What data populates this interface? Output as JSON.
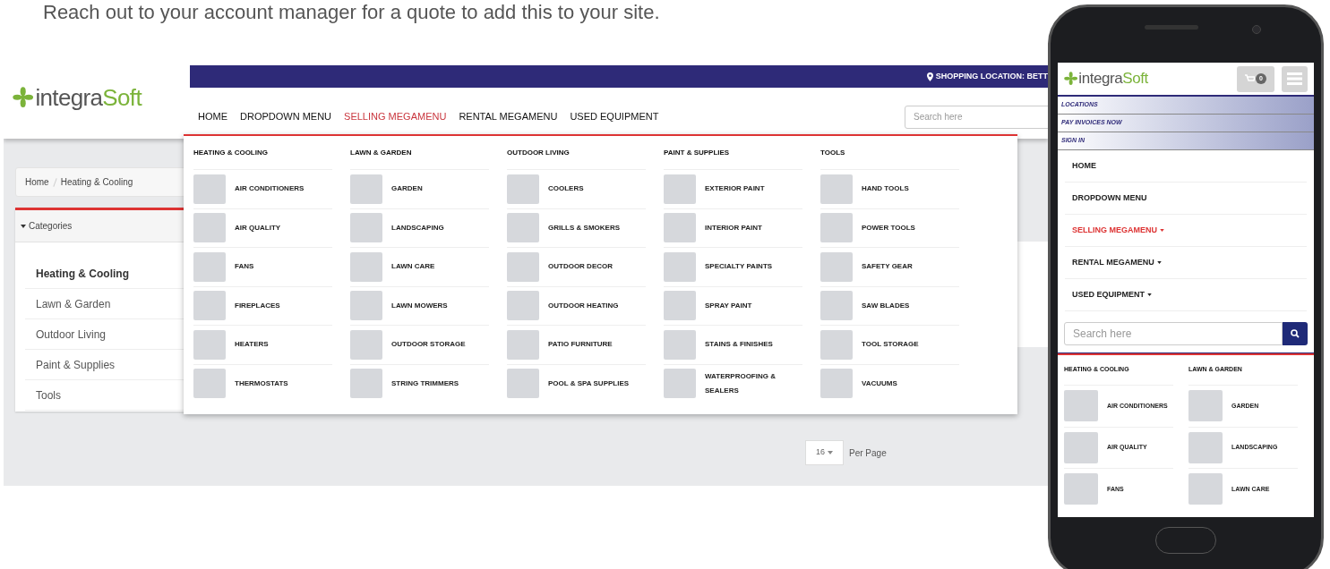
{
  "caption": "Reach out to your account manager for a quote to add this to your site.",
  "desktop": {
    "logo": {
      "part_1": "integra",
      "part_2": "Soft"
    },
    "location": "SHOPPING LOCATION: BETT",
    "nav": [
      {
        "label": "HOME",
        "selected": false
      },
      {
        "label": "DROPDOWN MENU",
        "selected": false
      },
      {
        "label": "SELLING MEGAMENU",
        "selected": true
      },
      {
        "label": "RENTAL MEGAMENU",
        "selected": false
      },
      {
        "label": "USED EQUIPMENT",
        "selected": false
      }
    ],
    "search": {
      "placeholder": "Search here"
    },
    "breadcrumb": [
      "Home",
      "Heating & Cooling"
    ],
    "categories": {
      "title": "Categories",
      "items": [
        {
          "label": "Heating & Cooling",
          "selected": true
        },
        {
          "label": "Lawn & Garden",
          "selected": false
        },
        {
          "label": "Outdoor Living",
          "selected": false
        },
        {
          "label": "Paint & Supplies",
          "selected": false
        },
        {
          "label": "Tools",
          "selected": false
        }
      ]
    },
    "megamenu": [
      {
        "heading": "HEATING & COOLING",
        "items": [
          "AIR CONDITIONERS",
          "AIR QUALITY",
          "FANS",
          "FIREPLACES",
          "HEATERS",
          "THERMOSTATS"
        ]
      },
      {
        "heading": "LAWN & GARDEN",
        "items": [
          "GARDEN",
          "LANDSCAPING",
          "LAWN CARE",
          "LAWN MOWERS",
          "OUTDOOR STORAGE",
          "STRING TRIMMERS"
        ]
      },
      {
        "heading": "OUTDOOR LIVING",
        "items": [
          "COOLERS",
          "GRILLS & SMOKERS",
          "OUTDOOR DECOR",
          "OUTDOOR HEATING",
          "PATIO FURNITURE",
          "POOL & SPA SUPPLIES"
        ]
      },
      {
        "heading": "PAINT & SUPPLIES",
        "items": [
          "EXTERIOR PAINT",
          "INTERIOR PAINT",
          "SPECIALTY PAINTS",
          "SPRAY PAINT",
          "STAINS & FINISHES",
          "WATERPROOFING & SEALERS"
        ]
      },
      {
        "heading": "TOOLS",
        "items": [
          "HAND TOOLS",
          "POWER TOOLS",
          "SAFETY GEAR",
          "SAW BLADES",
          "TOOL STORAGE",
          "VACUUMS"
        ]
      }
    ],
    "per_page": {
      "value": "16",
      "label": "Per Page"
    }
  },
  "phone": {
    "logo": {
      "part_1": "integra",
      "part_2": "Soft"
    },
    "cart_count": "0",
    "links": [
      "LOCATIONS",
      "PAY INVOICES NOW",
      "SIGN IN"
    ],
    "nav": [
      {
        "label": "HOME",
        "selected": false,
        "dropdown": false
      },
      {
        "label": "DROPDOWN MENU",
        "selected": false,
        "dropdown": false
      },
      {
        "label": "SELLING MEGAMENU",
        "selected": true,
        "dropdown": true
      },
      {
        "label": "RENTAL MEGAMENU",
        "selected": false,
        "dropdown": true
      },
      {
        "label": "USED EQUIPMENT",
        "selected": false,
        "dropdown": true
      }
    ],
    "search": {
      "placeholder": "Search here"
    },
    "megamenu": [
      {
        "heading": "HEATING & COOLING",
        "items": [
          "AIR CONDITIONERS",
          "AIR QUALITY",
          "FANS"
        ]
      },
      {
        "heading": "LAWN & GARDEN",
        "items": [
          "GARDEN",
          "LANDSCAPING",
          "LAWN CARE"
        ]
      }
    ]
  }
}
